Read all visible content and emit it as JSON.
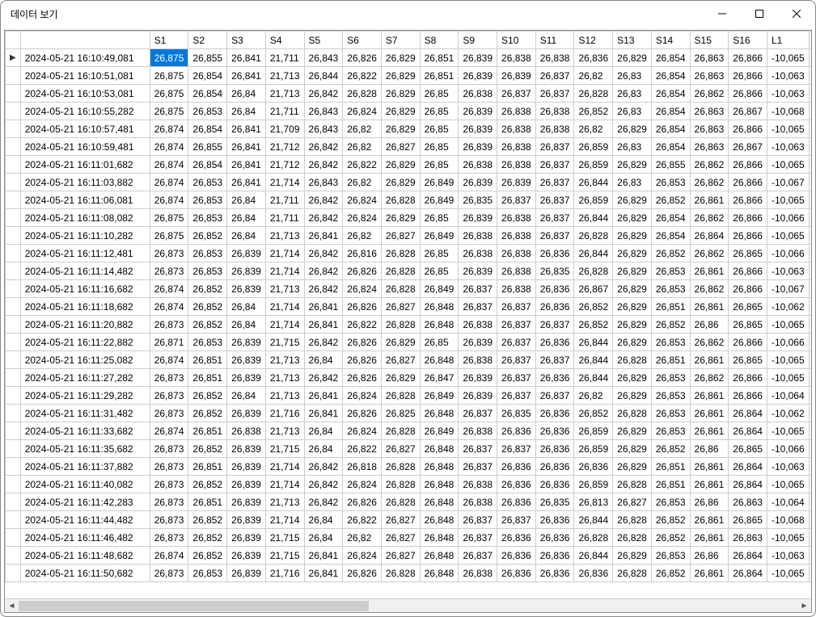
{
  "window": {
    "title": "데이터 보기"
  },
  "columns": [
    "",
    "",
    "S1",
    "S2",
    "S3",
    "S4",
    "S5",
    "S6",
    "S7",
    "S8",
    "S9",
    "S10",
    "S11",
    "S12",
    "S13",
    "S14",
    "S15",
    "S16",
    "L1",
    ""
  ],
  "rows": [
    {
      "cur": true,
      "ts": "2024-05-21 16:10:49,081",
      "v": [
        "26,875",
        "26,855",
        "26,841",
        "21,711",
        "26,843",
        "26,826",
        "26,829",
        "26,851",
        "26,839",
        "26,838",
        "26,838",
        "26,836",
        "26,829",
        "26,854",
        "26,863",
        "26,866",
        "-10,065",
        "-"
      ]
    },
    {
      "ts": "2024-05-21 16:10:51,081",
      "v": [
        "26,875",
        "26,854",
        "26,841",
        "21,713",
        "26,844",
        "26,822",
        "26,829",
        "26,851",
        "26,839",
        "26,839",
        "26,837",
        "26,82",
        "26,83",
        "26,854",
        "26,863",
        "26,866",
        "-10,063",
        "-"
      ]
    },
    {
      "ts": "2024-05-21 16:10:53,081",
      "v": [
        "26,875",
        "26,854",
        "26,84",
        "21,713",
        "26,842",
        "26,828",
        "26,829",
        "26,85",
        "26,838",
        "26,837",
        "26,837",
        "26,828",
        "26,83",
        "26,854",
        "26,862",
        "26,866",
        "-10,063",
        "-"
      ]
    },
    {
      "ts": "2024-05-21 16:10:55,282",
      "v": [
        "26,875",
        "26,853",
        "26,84",
        "21,711",
        "26,843",
        "26,824",
        "26,829",
        "26,85",
        "26,839",
        "26,838",
        "26,838",
        "26,852",
        "26,83",
        "26,854",
        "26,863",
        "26,867",
        "-10,068",
        "-"
      ]
    },
    {
      "ts": "2024-05-21 16:10:57,481",
      "v": [
        "26,874",
        "26,854",
        "26,841",
        "21,709",
        "26,843",
        "26,82",
        "26,829",
        "26,85",
        "26,839",
        "26,838",
        "26,838",
        "26,82",
        "26,829",
        "26,854",
        "26,863",
        "26,866",
        "-10,065",
        "-"
      ]
    },
    {
      "ts": "2024-05-21 16:10:59,481",
      "v": [
        "26,874",
        "26,855",
        "26,841",
        "21,712",
        "26,842",
        "26,82",
        "26,827",
        "26,85",
        "26,839",
        "26,838",
        "26,837",
        "26,859",
        "26,83",
        "26,854",
        "26,863",
        "26,867",
        "-10,063",
        "-"
      ]
    },
    {
      "ts": "2024-05-21 16:11:01,682",
      "v": [
        "26,874",
        "26,854",
        "26,841",
        "21,712",
        "26,842",
        "26,822",
        "26,829",
        "26,85",
        "26,838",
        "26,838",
        "26,837",
        "26,859",
        "26,829",
        "26,855",
        "26,862",
        "26,866",
        "-10,065",
        "-"
      ]
    },
    {
      "ts": "2024-05-21 16:11:03,882",
      "v": [
        "26,874",
        "26,853",
        "26,841",
        "21,714",
        "26,843",
        "26,82",
        "26,829",
        "26,849",
        "26,839",
        "26,839",
        "26,837",
        "26,844",
        "26,83",
        "26,853",
        "26,862",
        "26,866",
        "-10,067",
        "-"
      ]
    },
    {
      "ts": "2024-05-21 16:11:06,081",
      "v": [
        "26,874",
        "26,853",
        "26,84",
        "21,711",
        "26,842",
        "26,824",
        "26,828",
        "26,849",
        "26,835",
        "26,837",
        "26,837",
        "26,859",
        "26,829",
        "26,852",
        "26,861",
        "26,866",
        "-10,065",
        "-"
      ]
    },
    {
      "ts": "2024-05-21 16:11:08,082",
      "v": [
        "26,875",
        "26,853",
        "26,84",
        "21,711",
        "26,842",
        "26,824",
        "26,829",
        "26,85",
        "26,839",
        "26,838",
        "26,837",
        "26,844",
        "26,829",
        "26,854",
        "26,862",
        "26,866",
        "-10,066",
        "-"
      ]
    },
    {
      "ts": "2024-05-21 16:11:10,282",
      "v": [
        "26,875",
        "26,852",
        "26,84",
        "21,713",
        "26,841",
        "26,82",
        "26,827",
        "26,849",
        "26,838",
        "26,838",
        "26,837",
        "26,828",
        "26,829",
        "26,854",
        "26,864",
        "26,866",
        "-10,065",
        "-"
      ]
    },
    {
      "ts": "2024-05-21 16:11:12,481",
      "v": [
        "26,873",
        "26,853",
        "26,839",
        "21,714",
        "26,842",
        "26,816",
        "26,828",
        "26,85",
        "26,838",
        "26,838",
        "26,836",
        "26,844",
        "26,829",
        "26,852",
        "26,862",
        "26,865",
        "-10,066",
        "-"
      ]
    },
    {
      "ts": "2024-05-21 16:11:14,482",
      "v": [
        "26,873",
        "26,853",
        "26,839",
        "21,714",
        "26,842",
        "26,826",
        "26,828",
        "26,85",
        "26,839",
        "26,838",
        "26,835",
        "26,828",
        "26,829",
        "26,853",
        "26,861",
        "26,866",
        "-10,063",
        "-"
      ]
    },
    {
      "ts": "2024-05-21 16:11:16,682",
      "v": [
        "26,874",
        "26,852",
        "26,839",
        "21,713",
        "26,842",
        "26,824",
        "26,828",
        "26,849",
        "26,837",
        "26,838",
        "26,836",
        "26,867",
        "26,829",
        "26,853",
        "26,862",
        "26,866",
        "-10,067",
        "-"
      ]
    },
    {
      "ts": "2024-05-21 16:11:18,682",
      "v": [
        "26,874",
        "26,852",
        "26,84",
        "21,714",
        "26,841",
        "26,826",
        "26,827",
        "26,848",
        "26,837",
        "26,837",
        "26,836",
        "26,852",
        "26,829",
        "26,851",
        "26,861",
        "26,865",
        "-10,062",
        "-"
      ]
    },
    {
      "ts": "2024-05-21 16:11:20,882",
      "v": [
        "26,873",
        "26,852",
        "26,84",
        "21,714",
        "26,841",
        "26,822",
        "26,828",
        "26,848",
        "26,838",
        "26,837",
        "26,837",
        "26,852",
        "26,829",
        "26,852",
        "26,86",
        "26,865",
        "-10,065",
        "-"
      ]
    },
    {
      "ts": "2024-05-21 16:11:22,882",
      "v": [
        "26,871",
        "26,853",
        "26,839",
        "21,715",
        "26,842",
        "26,826",
        "26,829",
        "26,85",
        "26,839",
        "26,837",
        "26,836",
        "26,844",
        "26,829",
        "26,853",
        "26,862",
        "26,866",
        "-10,066",
        "-"
      ]
    },
    {
      "ts": "2024-05-21 16:11:25,082",
      "v": [
        "26,874",
        "26,851",
        "26,839",
        "21,713",
        "26,84",
        "26,826",
        "26,827",
        "26,848",
        "26,838",
        "26,837",
        "26,837",
        "26,844",
        "26,828",
        "26,851",
        "26,861",
        "26,865",
        "-10,065",
        "-"
      ]
    },
    {
      "ts": "2024-05-21 16:11:27,282",
      "v": [
        "26,873",
        "26,851",
        "26,839",
        "21,713",
        "26,842",
        "26,826",
        "26,829",
        "26,847",
        "26,839",
        "26,837",
        "26,836",
        "26,844",
        "26,829",
        "26,853",
        "26,862",
        "26,866",
        "-10,065",
        "-"
      ]
    },
    {
      "ts": "2024-05-21 16:11:29,282",
      "v": [
        "26,873",
        "26,852",
        "26,84",
        "21,713",
        "26,841",
        "26,824",
        "26,828",
        "26,849",
        "26,839",
        "26,837",
        "26,837",
        "26,82",
        "26,829",
        "26,853",
        "26,861",
        "26,866",
        "-10,064",
        "-"
      ]
    },
    {
      "ts": "2024-05-21 16:11:31,482",
      "v": [
        "26,873",
        "26,852",
        "26,839",
        "21,716",
        "26,841",
        "26,826",
        "26,825",
        "26,848",
        "26,837",
        "26,835",
        "26,836",
        "26,852",
        "26,828",
        "26,853",
        "26,861",
        "26,864",
        "-10,062",
        "-"
      ]
    },
    {
      "ts": "2024-05-21 16:11:33,682",
      "v": [
        "26,874",
        "26,851",
        "26,838",
        "21,713",
        "26,84",
        "26,824",
        "26,828",
        "26,849",
        "26,838",
        "26,836",
        "26,836",
        "26,859",
        "26,829",
        "26,853",
        "26,861",
        "26,864",
        "-10,065",
        "-"
      ]
    },
    {
      "ts": "2024-05-21 16:11:35,682",
      "v": [
        "26,873",
        "26,852",
        "26,839",
        "21,715",
        "26,84",
        "26,822",
        "26,827",
        "26,848",
        "26,837",
        "26,837",
        "26,836",
        "26,859",
        "26,829",
        "26,852",
        "26,86",
        "26,865",
        "-10,066",
        "-"
      ]
    },
    {
      "ts": "2024-05-21 16:11:37,882",
      "v": [
        "26,873",
        "26,851",
        "26,839",
        "21,714",
        "26,842",
        "26,818",
        "26,828",
        "26,848",
        "26,837",
        "26,836",
        "26,836",
        "26,836",
        "26,829",
        "26,851",
        "26,861",
        "26,864",
        "-10,063",
        "-"
      ]
    },
    {
      "ts": "2024-05-21 16:11:40,082",
      "v": [
        "26,873",
        "26,852",
        "26,839",
        "21,714",
        "26,842",
        "26,824",
        "26,828",
        "26,848",
        "26,838",
        "26,836",
        "26,836",
        "26,859",
        "26,828",
        "26,851",
        "26,861",
        "26,864",
        "-10,065",
        "-"
      ]
    },
    {
      "ts": "2024-05-21 16:11:42,283",
      "v": [
        "26,873",
        "26,851",
        "26,839",
        "21,713",
        "26,842",
        "26,826",
        "26,828",
        "26,848",
        "26,838",
        "26,836",
        "26,835",
        "26,813",
        "26,827",
        "26,853",
        "26,86",
        "26,863",
        "-10,064",
        "-"
      ]
    },
    {
      "ts": "2024-05-21 16:11:44,482",
      "v": [
        "26,873",
        "26,852",
        "26,839",
        "21,714",
        "26,84",
        "26,822",
        "26,827",
        "26,848",
        "26,837",
        "26,837",
        "26,836",
        "26,844",
        "26,828",
        "26,852",
        "26,861",
        "26,865",
        "-10,068",
        "-"
      ]
    },
    {
      "ts": "2024-05-21 16:11:46,482",
      "v": [
        "26,873",
        "26,852",
        "26,839",
        "21,715",
        "26,84",
        "26,82",
        "26,827",
        "26,848",
        "26,837",
        "26,836",
        "26,836",
        "26,828",
        "26,828",
        "26,852",
        "26,861",
        "26,863",
        "-10,065",
        "-"
      ]
    },
    {
      "ts": "2024-05-21 16:11:48,682",
      "v": [
        "26,874",
        "26,852",
        "26,839",
        "21,715",
        "26,841",
        "26,824",
        "26,827",
        "26,848",
        "26,837",
        "26,836",
        "26,836",
        "26,844",
        "26,829",
        "26,853",
        "26,86",
        "26,864",
        "-10,063",
        "-"
      ]
    },
    {
      "ts": "2024-05-21 16:11:50,682",
      "v": [
        "26,873",
        "26,853",
        "26,839",
        "21,716",
        "26,841",
        "26,826",
        "26,828",
        "26,848",
        "26,838",
        "26,836",
        "26,836",
        "26,836",
        "26,828",
        "26,852",
        "26,861",
        "26,864",
        "-10,065",
        "-"
      ]
    }
  ]
}
